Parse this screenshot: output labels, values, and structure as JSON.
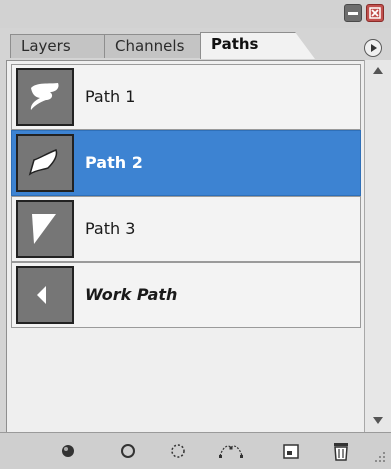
{
  "window": {
    "minimize_icon": "minimize-icon",
    "close_icon": "close-icon",
    "close_color": "#c0504d"
  },
  "tabs": [
    {
      "label": "Layers"
    },
    {
      "label": "Channels"
    },
    {
      "label": "Paths",
      "active": true
    }
  ],
  "panel_menu_icon": "flyout-menu-icon",
  "paths": [
    {
      "label": "Path 1",
      "selected": false
    },
    {
      "label": "Path 2",
      "selected": true
    },
    {
      "label": "Path 3",
      "selected": false
    },
    {
      "label": "Work Path",
      "selected": false,
      "italic": true
    }
  ],
  "selection_color": "#3d83d2",
  "toolbar": {
    "icons": [
      "fill-path-icon",
      "stroke-path-icon",
      "load-selection-icon",
      "make-work-path-icon",
      "new-path-icon",
      "delete-path-icon"
    ]
  }
}
